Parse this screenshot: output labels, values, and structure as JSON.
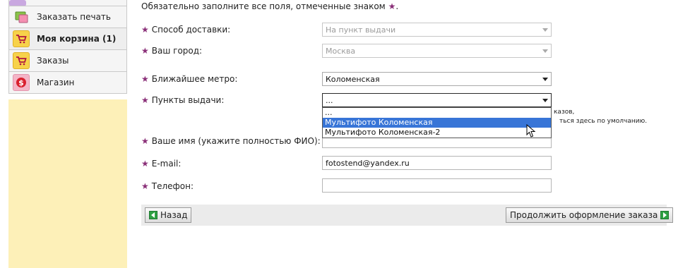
{
  "sidebar": {
    "items": [
      {
        "label": "",
        "icon": "stub-icon"
      },
      {
        "label": "Заказать печать",
        "icon": "print-order-icon"
      },
      {
        "label": "Моя корзина (1)",
        "icon": "cart-icon",
        "active": true
      },
      {
        "label": "Заказы",
        "icon": "orders-cart-icon"
      },
      {
        "label": "Магазин",
        "icon": "shop-dollar-icon"
      }
    ]
  },
  "form": {
    "intro": "Обязательно заполните все поля, отмеченные знаком",
    "intro_end": ".",
    "star": "★",
    "fields": {
      "delivery": {
        "label": "Способ доставки:",
        "value": "На пункт выдачи"
      },
      "city": {
        "label": "Ваш город:",
        "value": "Москва"
      },
      "metro": {
        "label": "Ближайшее метро:",
        "value": "Коломенская"
      },
      "pickup": {
        "label": "Пункты выдачи:",
        "value": "..."
      },
      "name": {
        "label": "Ваше имя (укажите полностью ФИО):",
        "value": ""
      },
      "email": {
        "label": "E-mail:",
        "value": "fotostend@yandex.ru"
      },
      "phone": {
        "label": "Телефон:",
        "value": ""
      }
    },
    "hint_line1": "казов,",
    "hint_line2": "ться здесь по умолчанию.",
    "dropdown_options": [
      "...",
      "Мультифото Коломенская",
      "Мультифото Коломенская-2"
    ],
    "dropdown_selected_index": 1
  },
  "buttons": {
    "back": "Назад",
    "next": "Продолжить оформление заказа"
  },
  "colors": {
    "star": "#8a2f78",
    "sidebar_fill": "#fdf0b8",
    "selected_option": "#3875d7",
    "button_icon": "#2ea043"
  }
}
